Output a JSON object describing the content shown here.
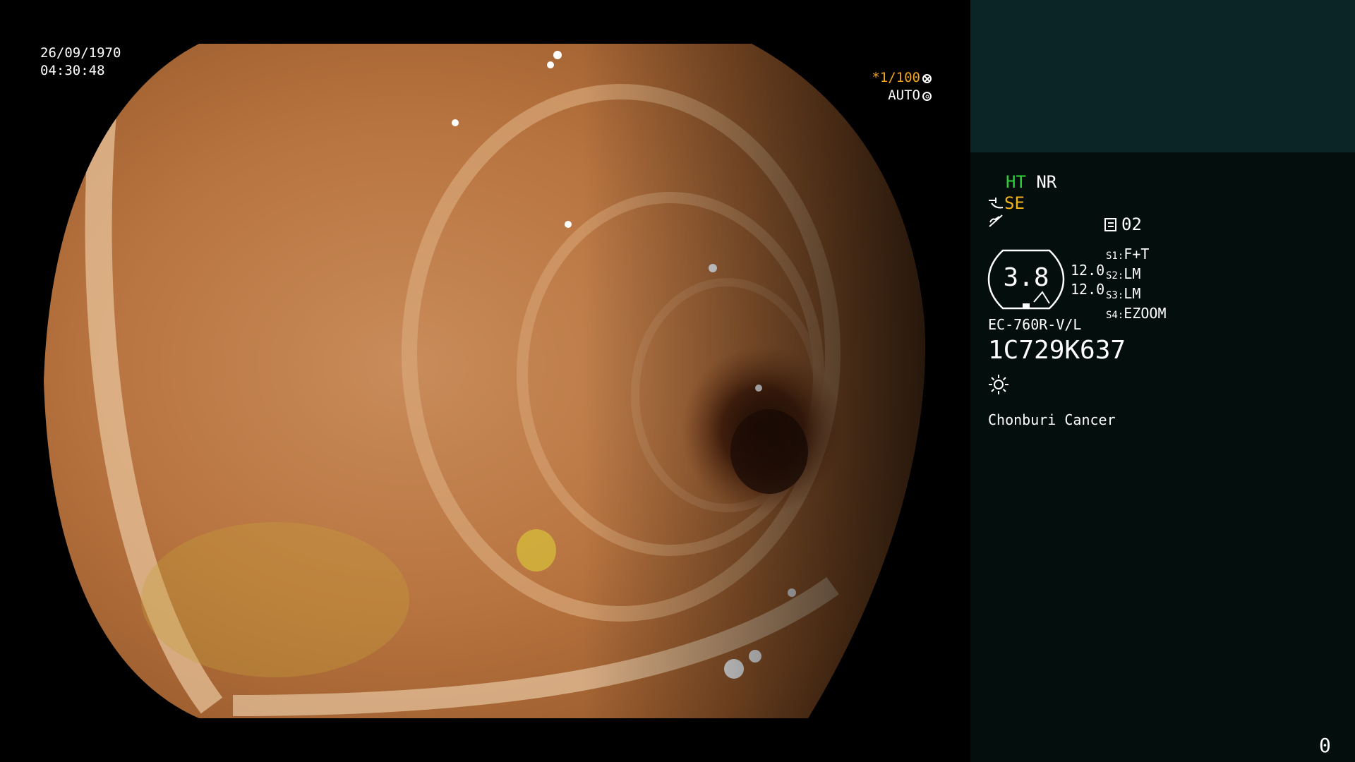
{
  "osd": {
    "date": "26/09/1970",
    "time": "04:30:48",
    "shutter_prefix": "*",
    "shutter_value": "1/100",
    "iris_mode": "AUTO"
  },
  "icons": {
    "shutter": "shutter-icon",
    "iris": "iris-icon",
    "structure_enhance": "enhance-icon",
    "freeze": "freeze-icon",
    "memo": "memo-icon",
    "light": "light-source-icon"
  },
  "panel": {
    "ht": "HT",
    "nr": "NR",
    "se": "SE",
    "memo_number": "02",
    "zoom": "3.8",
    "focus_values": [
      "12.0",
      "12.0"
    ],
    "switches": [
      {
        "key": "S1:",
        "value": "F+T"
      },
      {
        "key": "S2:",
        "value": "LM"
      },
      {
        "key": "S3:",
        "value": "LM"
      },
      {
        "key": "S4:",
        "value": "EZOOM"
      }
    ],
    "scope_model": "EC-760R-V/L",
    "scope_serial": "1C729K637",
    "institution": "Chonburi Cancer",
    "frame_counter": "0"
  },
  "colors": {
    "panel_bg": "#040e0d",
    "panel_header": "#0b2526",
    "ht_green": "#2fd33a",
    "se_yellow": "#f2b21a",
    "shutter_orange": "#f2a31a"
  }
}
